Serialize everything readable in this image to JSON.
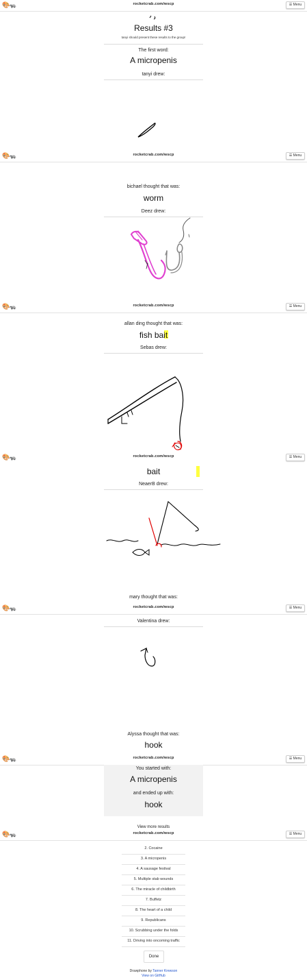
{
  "app": {
    "logo": "🎨🦡",
    "url": "rocketcrab.com/wscp",
    "menu_label": "☰ Menu"
  },
  "results": {
    "title": "Results #3",
    "subtitle": "tanyi should present these results to the group!"
  },
  "steps": [
    {
      "thought_label": "The first word:",
      "word": "A micropenis",
      "drew_label": "tanyi drew:"
    },
    {
      "thought_label": "bichael thought that was:",
      "word": "worm",
      "drew_label": "Deez drew:"
    },
    {
      "thought_label": "allan ding thought that was:",
      "word": "fish bait",
      "drew_label": "Sebas drew:"
    },
    {
      "word": "bait",
      "drew_label": "NeaerB drew:"
    },
    {
      "thought_label": "mary thought that was:",
      "drew_label": "Valentina drew:"
    },
    {
      "thought_label": "Alyssa thought that was:",
      "word": "hook"
    }
  ],
  "summary": {
    "started_label": "You started with:",
    "start_word": "A micropenis",
    "ended_label": "and ended up with:",
    "end_word": "hook",
    "more_label": "View more results"
  },
  "results_list": [
    "2. Cocaine",
    "3. A micropenis",
    "4. A sausage festival",
    "5. Multiple stab wounds",
    "6. The miracle of childbirth",
    "7. Buffetz",
    "8. The heart of a child",
    "9. Republicans",
    "10. Scrubbing under the folds",
    "11. Driving into oncoming traffic"
  ],
  "done_label": "Done",
  "footer": {
    "line1_text": "Drawphone by",
    "line1_link": "Tanner Krewson",
    "line2_link": "View on GitHub"
  },
  "colors": {
    "drawing_pink": "#e040d0",
    "drawing_gray": "#808080",
    "drawing_red": "#e00000",
    "highlight_yellow": "#ffff40",
    "link_blue": "#2255cc"
  }
}
